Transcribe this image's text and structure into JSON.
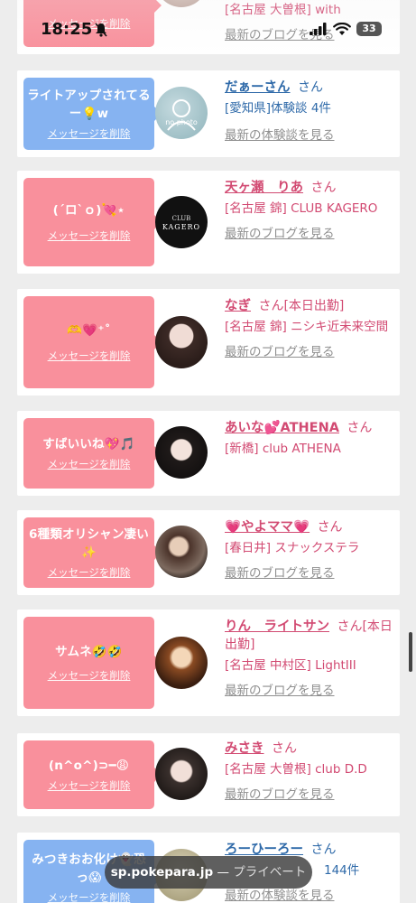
{
  "status": {
    "time": "18:25",
    "battery": "33",
    "icons": [
      "bell-slash-icon",
      "signal-icon",
      "wifi-icon",
      "battery-icon"
    ]
  },
  "cards": [
    {
      "bubble_color": "pink",
      "message": "",
      "delete_label": "メッセージを削除",
      "name": "",
      "honorific": "",
      "location": "[名古屋 大曽根] with",
      "link": "最新のブログを見る",
      "name_color": "pink"
    },
    {
      "bubble_color": "blue",
      "message": "ライトアップされてるー💡w",
      "delete_label": "メッセージを削除",
      "avatar_text": "no photo",
      "name": "だぁーさん",
      "honorific": "さん",
      "location": "[愛知県]体験談 4件",
      "link": "最新の体験談を見る",
      "name_color": "blue"
    },
    {
      "bubble_color": "pink",
      "message": "(´ロ`ｏ)💘⋆",
      "delete_label": "メッセージを削除",
      "avatar_text": "CLUB KAGERO",
      "name": "天ヶ瀬　りあ",
      "honorific": "さん",
      "location": "[名古屋 錦] CLUB KAGERO",
      "link": "最新のブログを見る",
      "name_color": "pink"
    },
    {
      "bubble_color": "pink",
      "message": "🫶💗⁺˚",
      "delete_label": "メッセージを削除",
      "name": "なぎ",
      "honorific": "さん[本日出勤]",
      "location": "[名古屋 錦] ニシキ近未来空間",
      "link": "最新のブログを見る",
      "name_color": "pink"
    },
    {
      "bubble_color": "pink",
      "message": "すばいいね💖🎵",
      "delete_label": "メッセージを削除",
      "name": "あいな💕ATHENA",
      "honorific": "さん",
      "location": "[新橋] club ATHENA",
      "link": "",
      "name_color": "pink"
    },
    {
      "bubble_color": "pink",
      "message": "6種類オリシャン凄い✨",
      "delete_label": "メッセージを削除",
      "name": "💗やよママ💗",
      "honorific": "さん",
      "location": "[春日井] スナックステラ",
      "link": "最新のブログを見る",
      "name_color": "pink"
    },
    {
      "bubble_color": "pink",
      "message": "サムネ🤣🤣",
      "delete_label": "メッセージを削除",
      "name": "りん　ライトサン",
      "honorific": "さん[本日出勤]",
      "location": "[名古屋 中村区] LightIII",
      "link": "最新のブログを見る",
      "name_color": "pink"
    },
    {
      "bubble_color": "pink",
      "message": "(n^o^)⊃━😩",
      "delete_label": "メッセージを削除",
      "name": "みさき",
      "honorific": "さん",
      "location": "[名古屋 大曽根] club D.D",
      "link": "最新のブログを見る",
      "name_color": "pink"
    },
    {
      "bubble_color": "blue",
      "message": "みつきおお化け👻恐っ😱",
      "delete_label": "メッセージを削除",
      "name": "ろーひーろー",
      "honorific": "さん",
      "location": "144件",
      "link": "最新の体験談を見る",
      "name_color": "blue"
    }
  ],
  "browser": {
    "host": "sp.pokepara.jp",
    "separator": "—",
    "mode": "プライベート"
  }
}
